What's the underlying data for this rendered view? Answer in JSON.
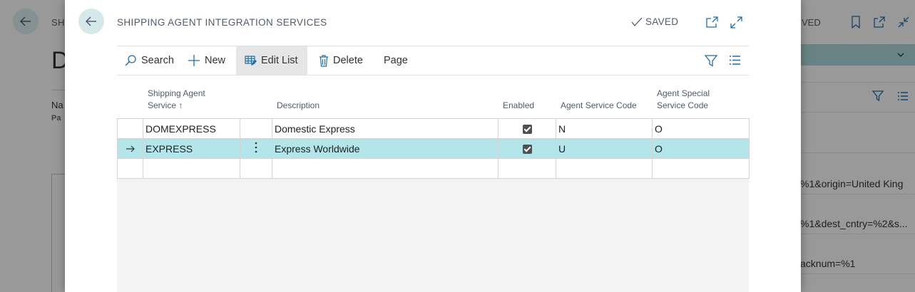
{
  "background": {
    "title_fragment": "SH",
    "big_letter": "D",
    "label_na": "Na",
    "label_pa": "Pa",
    "saved_fragment": "VED",
    "url_fragments": [
      "%1&origin=United King",
      "%1&dest_cntry=%2&s...",
      "acknum=%1"
    ]
  },
  "modal": {
    "title": "SHIPPING AGENT INTEGRATION SERVICES",
    "saved_label": "SAVED"
  },
  "actions": {
    "search": "Search",
    "new": "New",
    "edit_list": "Edit List",
    "delete": "Delete",
    "page": "Page"
  },
  "columns": {
    "shipping_agent_service": "Shipping Agent Service",
    "sort_indicator": "↑",
    "description": "Description",
    "enabled": "Enabled",
    "agent_service_code": "Agent Service Code",
    "agent_special_service_code": "Agent Special Service Code"
  },
  "rows": [
    {
      "service": "DOMEXPRESS",
      "description": "Domestic Express",
      "enabled": true,
      "agent_service_code": "N",
      "agent_special_service_code": "O"
    },
    {
      "service": "EXPRESS",
      "description": "Express Worldwide",
      "enabled": true,
      "agent_service_code": "U",
      "agent_special_service_code": "O"
    }
  ],
  "colors": {
    "accent": "#b3e6ea",
    "back_button": "#d6e9ea",
    "header_text": "#505c6d",
    "icon_blue": "#1f6fa8"
  }
}
